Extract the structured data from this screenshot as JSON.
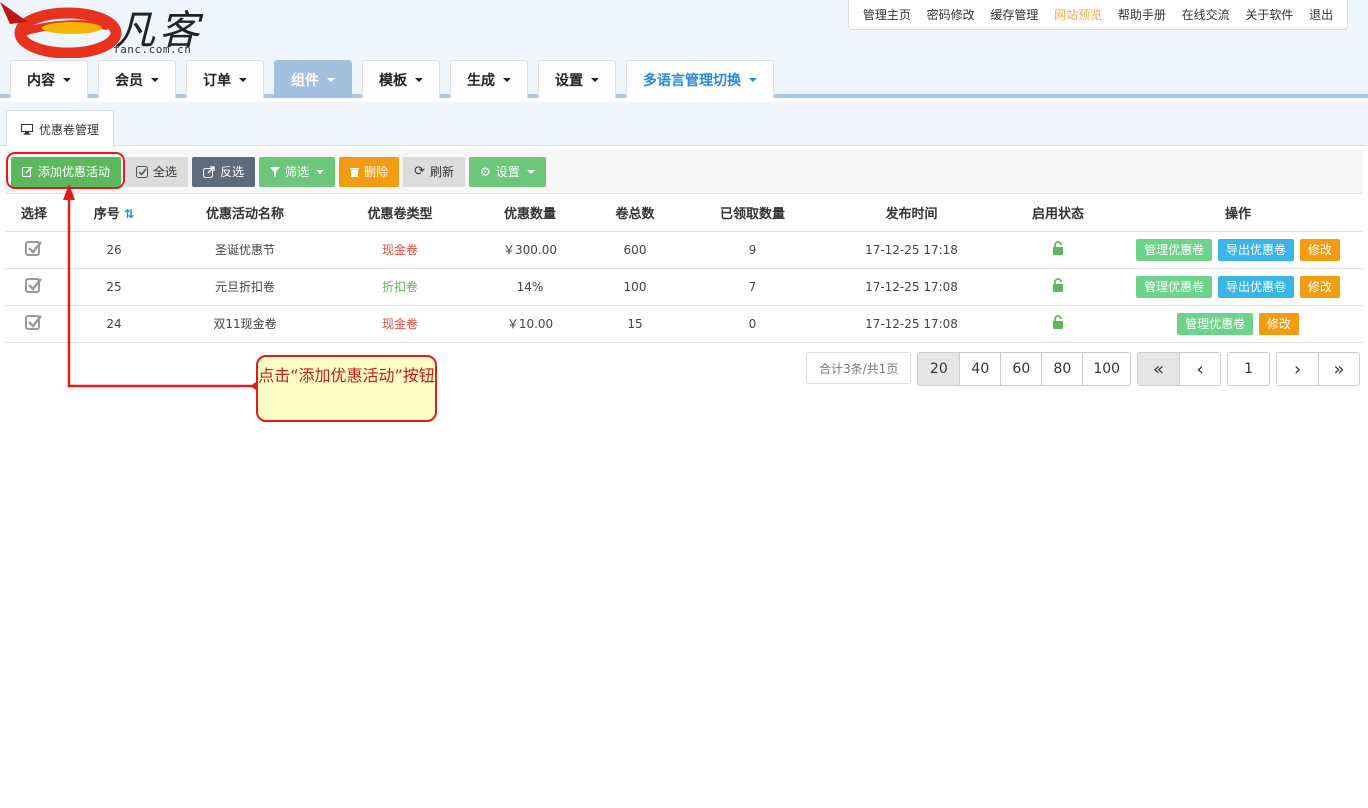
{
  "logo": {
    "cn": "凡客",
    "domain": "fanc.com.cn"
  },
  "topnav": [
    {
      "label": "管理主页"
    },
    {
      "label": "密码修改"
    },
    {
      "label": "缓存管理"
    },
    {
      "label": "网站预览",
      "highlight": true
    },
    {
      "label": "帮助手册"
    },
    {
      "label": "在线交流"
    },
    {
      "label": "关于软件"
    },
    {
      "label": "退出"
    }
  ],
  "mainnav": [
    {
      "label": "内容"
    },
    {
      "label": "会员"
    },
    {
      "label": "订单"
    },
    {
      "label": "组件",
      "active": true
    },
    {
      "label": "模板"
    },
    {
      "label": "生成"
    },
    {
      "label": "设置"
    },
    {
      "label": "多语言管理切换"
    }
  ],
  "subtab": {
    "label": "优惠卷管理",
    "icon": "monitor-icon"
  },
  "toolbar": {
    "add": "添加优惠活动",
    "select_all": "全选",
    "invert": "反选",
    "filter": "筛选",
    "delete": "删除",
    "refresh": "刷新",
    "settings": "设置"
  },
  "table": {
    "headers": [
      "选择",
      "序号",
      "优惠活动名称",
      "优惠卷类型",
      "优惠数量",
      "卷总数",
      "已领取数量",
      "发布时间",
      "启用状态",
      "操作"
    ],
    "rows": [
      {
        "id": "26",
        "name": "圣诞优惠节",
        "type": "现金卷",
        "type_color": "red",
        "amount": "￥300.00",
        "total": "600",
        "claimed": "9",
        "time": "17-12-25 17:18",
        "actions": [
          "管理优惠卷",
          "导出优惠卷",
          "修改"
        ]
      },
      {
        "id": "25",
        "name": "元旦折扣卷",
        "type": "折扣卷",
        "type_color": "green",
        "amount": "14%",
        "total": "100",
        "claimed": "7",
        "time": "17-12-25 17:08",
        "actions": [
          "管理优惠卷",
          "导出优惠卷",
          "修改"
        ]
      },
      {
        "id": "24",
        "name": "双11现金卷",
        "type": "现金卷",
        "type_color": "red",
        "amount": "￥10.00",
        "total": "15",
        "claimed": "0",
        "time": "17-12-25 17:08",
        "actions": [
          "管理优惠卷",
          "修改"
        ]
      }
    ]
  },
  "pager": {
    "info": "合计3条/共1页",
    "sizes": [
      "20",
      "40",
      "60",
      "80",
      "100"
    ],
    "active_size": "20",
    "first": "«",
    "prev": "‹",
    "page": "1",
    "next": "›",
    "last": "»"
  },
  "annotation": {
    "text": "点击“添加优惠活动”按钮"
  },
  "colors": {
    "accent": "#5cb85c",
    "annot": "#e21b1b",
    "nav_active": "#a4c0df"
  }
}
